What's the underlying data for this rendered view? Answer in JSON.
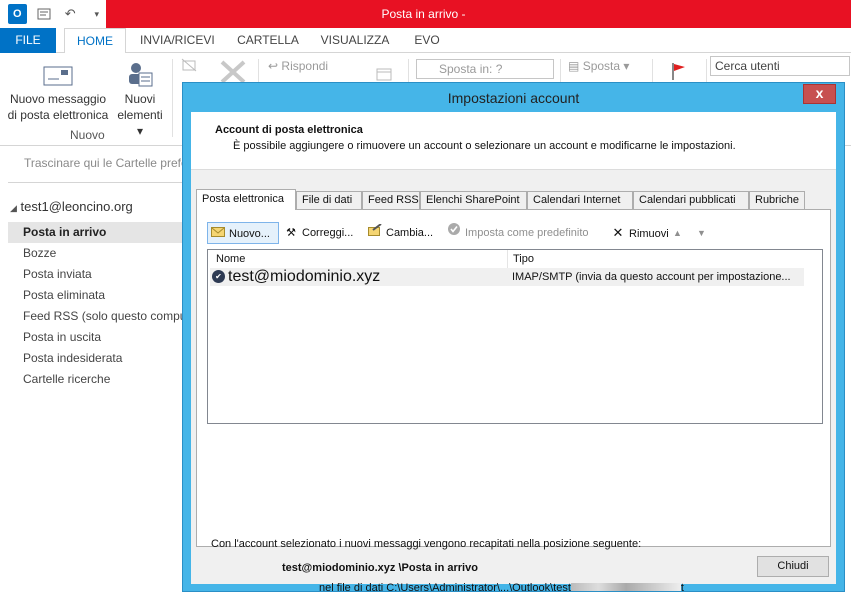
{
  "window": {
    "title": "Posta in arrivo -"
  },
  "qat": {
    "outlook_glyph": "O",
    "undo_glyph": "↶"
  },
  "tabs": [
    "FILE",
    "HOME",
    "INVIA/RICEVI",
    "CARTELLA",
    "VISUALIZZA",
    "EVO"
  ],
  "ribbon": {
    "new_message_line1": "Nuovo messaggio",
    "new_message_line2": "di posta elettronica",
    "new_items_line1": "Nuovi",
    "new_items_line2": "elementi ▾",
    "group_label": "Nuovo",
    "reply": "Rispondi",
    "move_to": "Sposta in: ?",
    "move": "Sposta ▾",
    "search_people": "Cerca utenti"
  },
  "nav": {
    "drag_hint": "Trascinare qui le Cartelle prefe",
    "account": "test1@leoncino.org",
    "folders": [
      "Posta in arrivo",
      "Bozze",
      "Posta inviata",
      "Posta eliminata",
      "Feed RSS (solo questo comput",
      "Posta in uscita",
      "Posta indesiderata",
      "Cartelle ricerche"
    ]
  },
  "dialog": {
    "title": "Impostazioni account",
    "close_glyph": "x",
    "header_title": "Account di posta elettronica",
    "header_subtitle": "È possibile aggiungere o rimuovere un account o selezionare un account e modificarne le impostazioni.",
    "tabs": [
      "Posta elettronica",
      "File di dati",
      "Feed RSS",
      "Elenchi SharePoint",
      "Calendari Internet",
      "Calendari pubblicati",
      "Rubriche"
    ],
    "toolbar": {
      "new": "Nuovo...",
      "repair": "Correggi...",
      "change": "Cambia...",
      "set_default": "Imposta come predefinito",
      "remove": "Rimuovi",
      "up": "▲",
      "down": "▼"
    },
    "list": {
      "col_name": "Nome",
      "col_type": "Tipo",
      "rows": [
        {
          "name": "test@miodominio.xyz",
          "type": "IMAP/SMTP (invia da questo account per impostazione..."
        }
      ]
    },
    "delivery_intro": "Con l'account selezionato i nuovi messaggi vengono recapitati nella posizione seguente:",
    "delivery_account": "test@miodominio.xyz \\Posta in arrivo",
    "delivery_file": "nel file di dati C:\\Users\\Administrator\\...\\Outlook\\test",
    "delivery_file_tail": "t",
    "close_button": "Chiudi"
  },
  "colors": {
    "accent": "#0072c6",
    "titlebar_red": "#e81123",
    "dialog_frame": "#45b5e8"
  }
}
